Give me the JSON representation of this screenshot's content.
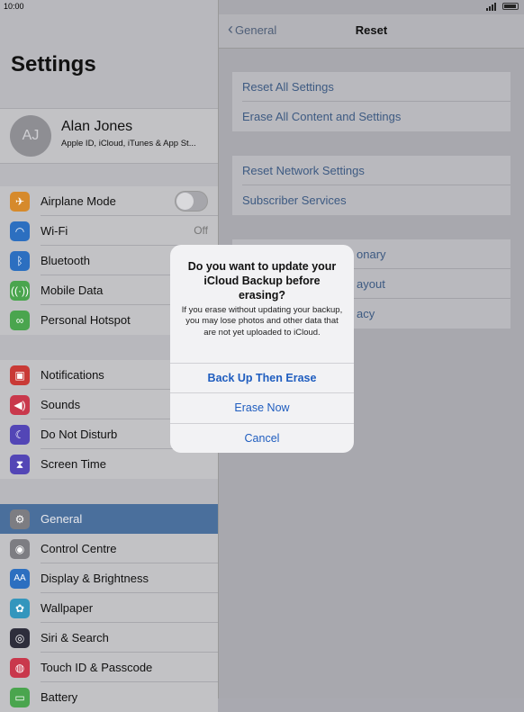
{
  "status_bar": {
    "time": "10:00"
  },
  "left_panel": {
    "title": "Settings",
    "profile": {
      "initials": "AJ",
      "name": "Alan Jones",
      "subtitle": "Apple ID, iCloud, iTunes & App St..."
    },
    "group1": [
      {
        "label": "Airplane Mode",
        "icon": "airplane-icon",
        "color": "#e0892a"
      },
      {
        "label": "Wi-Fi",
        "icon": "wifi-icon",
        "color": "#2d7ed6",
        "value": "Off"
      },
      {
        "label": "Bluetooth",
        "icon": "bluetooth-icon",
        "color": "#2d7ed6"
      },
      {
        "label": "Mobile Data",
        "icon": "antenna-icon",
        "color": "#4caf50"
      },
      {
        "label": "Personal Hotspot",
        "icon": "hotspot-icon",
        "color": "#4caf50"
      }
    ],
    "group2": [
      {
        "label": "Notifications",
        "icon": "notifications-icon",
        "color": "#d93a35"
      },
      {
        "label": "Sounds",
        "icon": "speaker-icon",
        "color": "#d9384f"
      },
      {
        "label": "Do Not Disturb",
        "icon": "moon-icon",
        "color": "#5b4fc4"
      },
      {
        "label": "Screen Time",
        "icon": "hourglass-icon",
        "color": "#5b4fc4"
      }
    ],
    "group3": [
      {
        "label": "General",
        "icon": "gear-icon",
        "color": "#8e8e93"
      },
      {
        "label": "Control Centre",
        "icon": "toggles-icon",
        "color": "#8e8e93"
      },
      {
        "label": "Display & Brightness",
        "icon": "text-size-icon",
        "color": "#2d7ed6"
      },
      {
        "label": "Wallpaper",
        "icon": "flower-icon",
        "color": "#36a3cf"
      },
      {
        "label": "Siri & Search",
        "icon": "siri-icon",
        "color": "#333344"
      },
      {
        "label": "Touch ID & Passcode",
        "icon": "fingerprint-icon",
        "color": "#d9384f"
      },
      {
        "label": "Battery",
        "icon": "battery-icon",
        "color": "#4caf50"
      }
    ]
  },
  "right_panel": {
    "back_label": "General",
    "title": "Reset",
    "group1": [
      "Reset All Settings",
      "Erase All Content and Settings"
    ],
    "group2": [
      "Reset Network Settings",
      "Subscriber Services"
    ],
    "group3_partial": [
      "onary",
      "ayout",
      "acy"
    ]
  },
  "alert": {
    "title": "Do you want to update your iCloud Backup before erasing?",
    "message": "If you erase without updating your backup, you may lose photos and other data that are not yet uploaded to iCloud.",
    "buttons": [
      "Back Up Then Erase",
      "Erase Now",
      "Cancel"
    ]
  }
}
